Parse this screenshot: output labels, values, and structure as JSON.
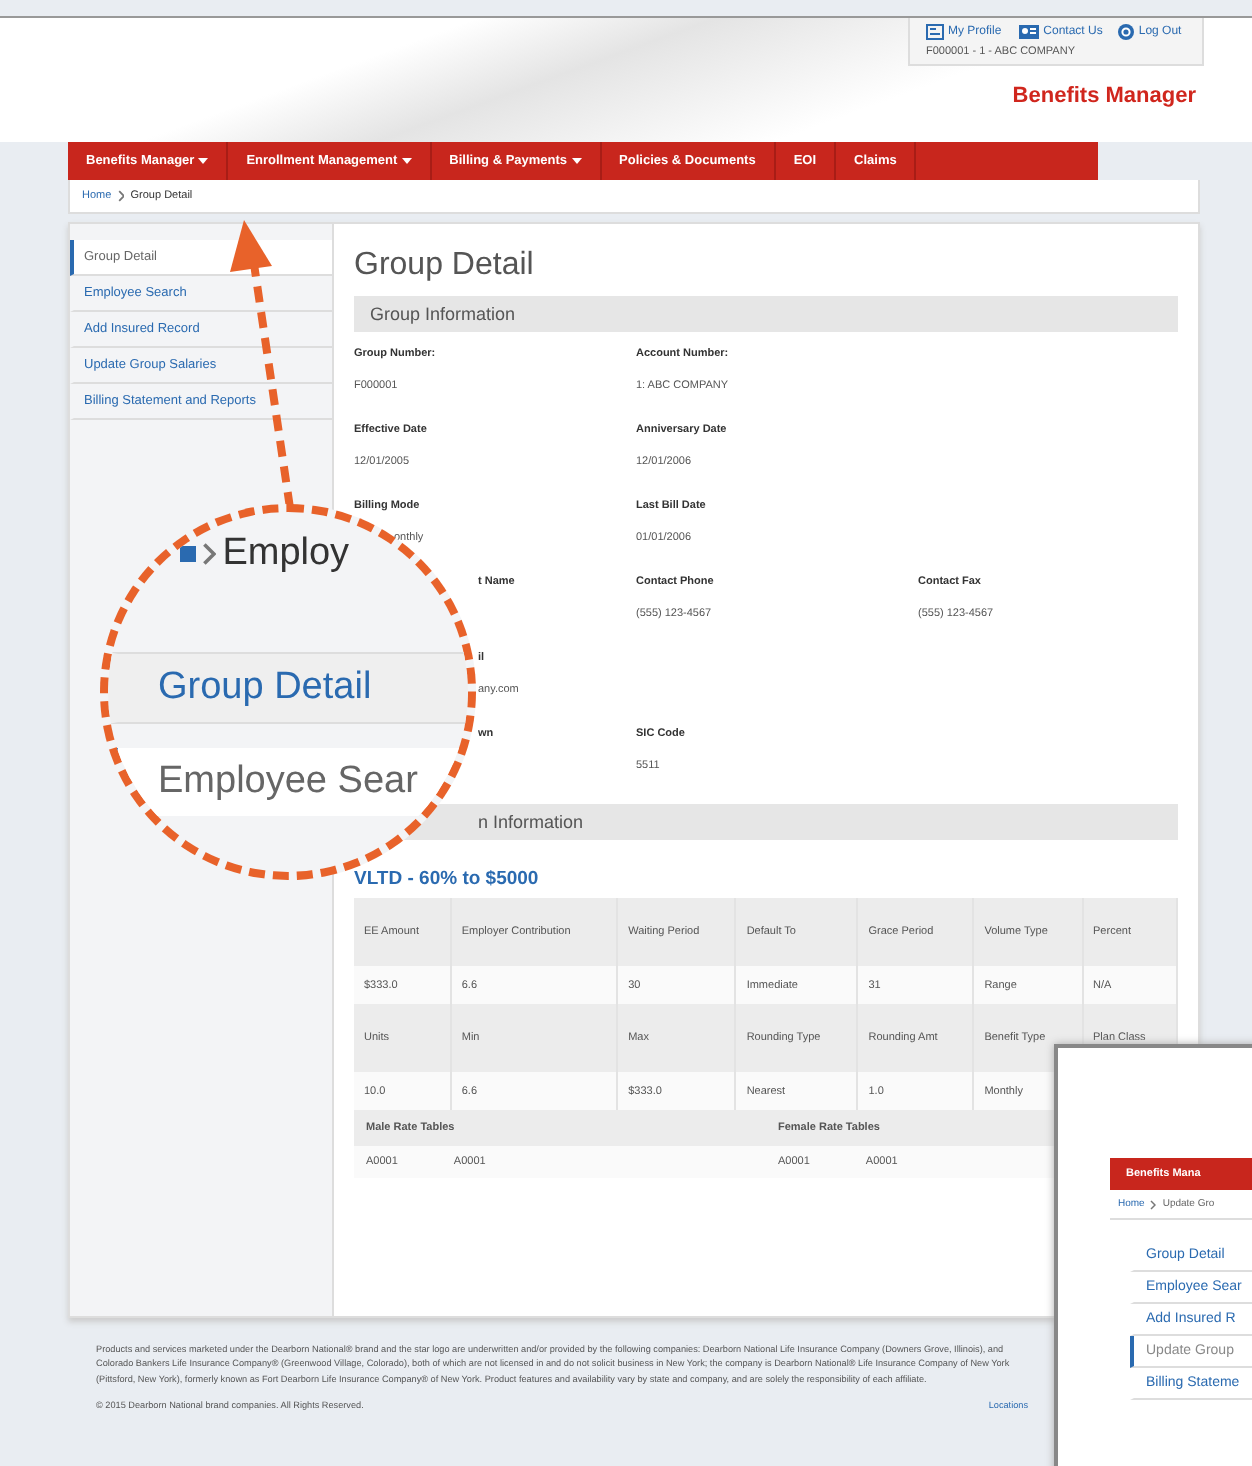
{
  "header": {
    "links": [
      {
        "label": "My Profile"
      },
      {
        "label": "Contact Us"
      },
      {
        "label": "Log Out"
      }
    ],
    "account": "F000001 - 1 - ABC COMPANY",
    "brand": "Benefits Manager"
  },
  "nav": [
    {
      "label": "Benefits Manager",
      "has_menu": true
    },
    {
      "label": "Enrollment Management",
      "has_menu": true
    },
    {
      "label": "Billing & Payments",
      "has_menu": true
    },
    {
      "label": "Policies & Documents",
      "has_menu": false
    },
    {
      "label": "EOI",
      "has_menu": false
    },
    {
      "label": "Claims",
      "has_menu": false
    }
  ],
  "breadcrumb": [
    "Home",
    "Group Detail"
  ],
  "sidebar": [
    {
      "label": "Group Detail",
      "selected": true
    },
    {
      "label": "Employee Search",
      "selected": false
    },
    {
      "label": "Add Insured Record",
      "selected": false
    },
    {
      "label": "Update Group Salaries",
      "selected": false
    },
    {
      "label": "Billing Statement and Reports",
      "selected": false
    }
  ],
  "page_title": "Group Detail",
  "section": "Group Information",
  "fields": [
    [
      {
        "kind": "full",
        "label": "Group Number:",
        "value": "F000001"
      },
      {
        "kind": "full",
        "label": "Account Number:",
        "value": "1: ABC COMPANY"
      }
    ],
    [
      {
        "kind": "full",
        "label": "Effective Date",
        "value": "12/01/2005"
      },
      {
        "kind": "full",
        "label": "Anniversary Date",
        "value": "12/01/2006"
      }
    ],
    [
      {
        "kind": "value_partial",
        "label": "Billing Mode",
        "value": "onthly"
      },
      {
        "kind": "full",
        "label": "Last Bill Date",
        "value": "01/01/2006"
      }
    ],
    [
      {
        "kind": "partial",
        "label": "t Name"
      },
      {
        "kind": "full",
        "label": "Contact Phone",
        "value": "(555) 123-4567"
      },
      {
        "kind": "full",
        "label": "Contact Fax",
        "value": "(555) 123-4567"
      }
    ],
    [
      {
        "kind": "partial",
        "label": "il",
        "value": "any.com"
      }
    ],
    [
      {
        "kind": "partial",
        "label": "wn"
      },
      {
        "kind": "full",
        "label": "SIC Code",
        "value": "5511"
      }
    ]
  ],
  "plan_section": "n Information",
  "plan_title": "VLTD - 60% to $5000",
  "plan_rows": [
    {
      "kind": "head",
      "cells": [
        "EE Amount",
        "Employer Contribution",
        "Waiting Period",
        "Default To",
        "Grace Period",
        "Volume Type",
        "Percent"
      ]
    },
    {
      "kind": "data",
      "cells": [
        "$333.0",
        "6.6",
        "30",
        "Immediate",
        "31",
        "Range",
        "N/A"
      ]
    },
    {
      "kind": "head",
      "cells": [
        "Units",
        "Min",
        "Max",
        "Rounding Type",
        "Rounding Amt",
        "Benefit Type",
        "Plan Class"
      ]
    },
    {
      "kind": "data",
      "cells": [
        "10.0",
        "6.6",
        "$333.0",
        "Nearest",
        "1.0",
        "Monthly"
      ]
    }
  ],
  "rate_tables": {
    "headers": [
      "Male Rate Tables",
      "Female Rate Tables"
    ],
    "values": [
      [
        "A0001",
        "A0001"
      ],
      [
        "A0001",
        "A0001"
      ]
    ]
  },
  "footer": {
    "disclaimer": "Products and services marketed under the Dearborn National® brand and the star logo are underwritten and/or provided by the following companies: Dearborn National Life Insurance Company (Downers Grove, Illinois), and Colorado Bankers Life Insurance Company® (Greenwood Village, Colorado), both of which are not licensed in and do not solicit business in New York; the company is Dearborn National® Life Insurance Company of New York (Pittsford, New York), formerly known as Fort Dearborn Life Insurance Company® of New York. Product features and availability vary by state and company, and are solely the responsibility of each affiliate.",
    "copyright": "© 2015 Dearborn National brand companies. All Rights Reserved.",
    "link": "Locations"
  },
  "magnifier": {
    "crumb": "Employ",
    "items": [
      {
        "label": "Group Detail",
        "selected": false
      },
      {
        "label": "Employee Sear",
        "selected": true
      }
    ]
  },
  "inset": {
    "nav_label": "Benefits Mana",
    "breadcrumb": [
      "Home",
      "Update Gro"
    ],
    "sidebar": [
      {
        "label": "Group Detail",
        "selected": false
      },
      {
        "label": "Employee Sear",
        "selected": false
      },
      {
        "label": "Add Insured R",
        "selected": false
      },
      {
        "label": "Update Group",
        "selected": true
      },
      {
        "label": "Billing Stateme",
        "selected": false
      }
    ]
  }
}
